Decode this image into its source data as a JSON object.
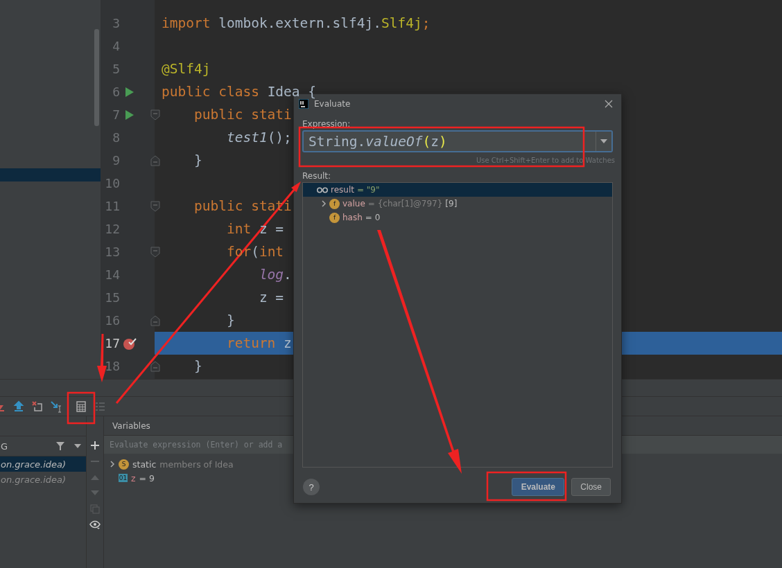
{
  "editor": {
    "lines": [
      {
        "number": "3",
        "tokens": [
          {
            "text": "import ",
            "kind": "keyword"
          },
          {
            "text": "lombok.extern.slf4j.",
            "kind": "plain"
          },
          {
            "text": "Slf4j",
            "kind": "annotation"
          },
          {
            "text": ";",
            "kind": "keyword"
          }
        ],
        "run": false,
        "breakpoint": false,
        "current": false
      },
      {
        "number": "4",
        "run": false,
        "breakpoint": false,
        "current": false
      },
      {
        "number": "5",
        "tokens": [
          {
            "text": "@Slf4j",
            "kind": "annotation"
          }
        ],
        "run": false,
        "breakpoint": false,
        "current": false
      },
      {
        "number": "6",
        "tokens": [
          {
            "text": "public class ",
            "kind": "keyword"
          },
          {
            "text": "Idea {",
            "kind": "plain"
          }
        ],
        "run": true,
        "breakpoint": false,
        "current": false
      },
      {
        "number": "7",
        "tokens": [
          {
            "text": "    public stati",
            "kind": "keyword"
          }
        ],
        "run": true,
        "breakpoint": false,
        "fold": {
          "kind": "start"
        },
        "current": false
      },
      {
        "number": "8",
        "tokens": [
          {
            "text": "        test1",
            "kind": "method"
          },
          {
            "text": "();",
            "kind": "plain"
          }
        ],
        "run": false,
        "breakpoint": false,
        "current": false
      },
      {
        "number": "9",
        "tokens": [
          {
            "text": "    }",
            "kind": "plain"
          }
        ],
        "run": false,
        "breakpoint": false,
        "fold": {
          "kind": "end"
        },
        "current": false
      },
      {
        "number": "10",
        "run": false,
        "breakpoint": false,
        "current": false
      },
      {
        "number": "11",
        "tokens": [
          {
            "text": "    public stati",
            "kind": "keyword"
          }
        ],
        "run": false,
        "breakpoint": false,
        "fold": {
          "kind": "start"
        },
        "current": false
      },
      {
        "number": "12",
        "tokens": [
          {
            "text": "        int ",
            "kind": "keyword"
          },
          {
            "text": "z =",
            "kind": "plain"
          }
        ],
        "run": false,
        "breakpoint": false,
        "current": false
      },
      {
        "number": "13",
        "tokens": [
          {
            "text": "        for",
            "kind": "keyword"
          },
          {
            "text": "(",
            "kind": "plain"
          },
          {
            "text": "int",
            "kind": "keyword"
          }
        ],
        "run": false,
        "breakpoint": false,
        "fold": {
          "kind": "start"
        },
        "current": false
      },
      {
        "number": "14",
        "tokens": [
          {
            "text": "            log",
            "kind": "field"
          },
          {
            "text": ".",
            "kind": "plain"
          }
        ],
        "run": false,
        "breakpoint": false,
        "current": false
      },
      {
        "number": "15",
        "tokens": [
          {
            "text": "            z =",
            "kind": "plain"
          }
        ],
        "run": false,
        "breakpoint": false,
        "current": false
      },
      {
        "number": "16",
        "tokens": [
          {
            "text": "        }",
            "kind": "plain"
          }
        ],
        "run": false,
        "breakpoint": false,
        "fold": {
          "kind": "end"
        },
        "current": false
      },
      {
        "number": "17",
        "tokens": [
          {
            "text": "        return ",
            "kind": "keyword"
          },
          {
            "text": "z",
            "kind": "plain"
          }
        ],
        "run": false,
        "breakpoint": true,
        "current": true
      },
      {
        "number": "18",
        "tokens": [
          {
            "text": "    }",
            "kind": "plain"
          }
        ],
        "run": false,
        "breakpoint": false,
        "fold": {
          "kind": "end"
        },
        "current": false
      }
    ]
  },
  "debugger": {
    "frames_header": "G",
    "frames": [
      {
        "text": "on.grace.idea)",
        "selected": true
      },
      {
        "text": "on.grace.idea)",
        "selected": false
      }
    ],
    "variables_title": "Variables",
    "watch_field": {
      "placeholder": "Evaluate expression (Enter) or add a"
    },
    "variables": [
      {
        "kind": "static",
        "badge": "S",
        "name": "static",
        "value": "members of Idea",
        "expandable": true
      },
      {
        "kind": "local",
        "badge": "01",
        "name": "z",
        "value": "= 9",
        "expandable": false
      }
    ]
  },
  "dialog": {
    "title": "Evaluate",
    "expression_label": "Expression:",
    "expression": [
      {
        "text": "String.",
        "kind": "plain"
      },
      {
        "text": "valueOf",
        "kind": "method"
      },
      {
        "text": "(",
        "kind": "paren"
      },
      {
        "text": "z",
        "kind": "plain"
      },
      {
        "text": ")",
        "kind": "paren"
      }
    ],
    "hint": "Use Ctrl+Shift+Enter to add to Watches",
    "result_label": "Result:",
    "result": [
      {
        "kind": "watch",
        "name": "result",
        "value": "= \"9\"",
        "selected": true,
        "expandable": false,
        "children": [
          {
            "kind": "field",
            "badge": "f",
            "name": "value",
            "type": "= {char[1]@797}",
            "value": "[9]",
            "selected": false,
            "expandable": true
          },
          {
            "kind": "field",
            "badge": "f",
            "name": "hash",
            "value": "= 0",
            "selected": false,
            "expandable": false
          }
        ]
      }
    ],
    "buttons": [
      {
        "label": "Evaluate",
        "default": true
      },
      {
        "label": "Close",
        "default": false
      }
    ],
    "help": "?"
  }
}
